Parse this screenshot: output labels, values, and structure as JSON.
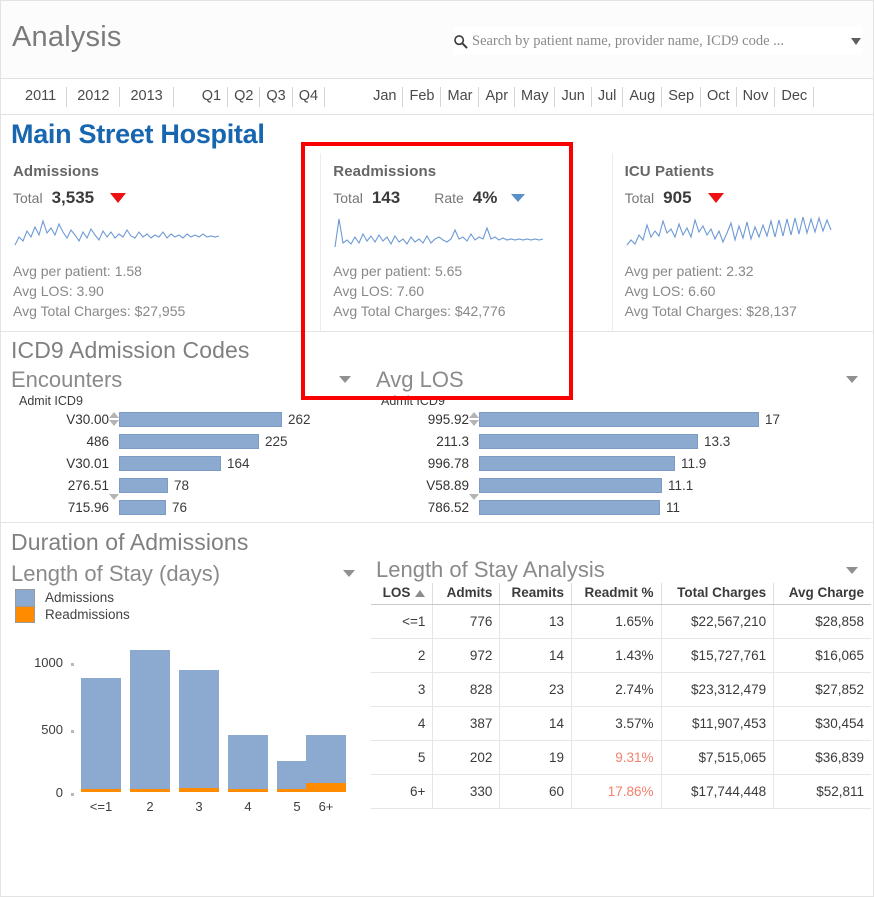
{
  "header": {
    "app_title": "Analysis",
    "search_placeholder": "Search by patient name, provider name, ICD9 code ...",
    "search_value": "",
    "search_icon": "search-icon",
    "dropdown_icon": "chevron-down-icon"
  },
  "filters": {
    "years": [
      "2011",
      "2012",
      "2013"
    ],
    "quarters": [
      "Q1",
      "Q2",
      "Q3",
      "Q4"
    ],
    "months": [
      "Jan",
      "Feb",
      "Mar",
      "Apr",
      "May",
      "Jun",
      "Jul",
      "Aug",
      "Sep",
      "Oct",
      "Nov",
      "Dec"
    ]
  },
  "hospital": {
    "name": "Main Street Hospital"
  },
  "cards": [
    {
      "title": "Admissions",
      "total_label": "Total",
      "total_value": "3,535",
      "secondary_label": "",
      "secondary_value": "",
      "caret_color": "#ee1111",
      "stats": [
        "Avg per patient: 1.58",
        "Avg LOS: 3.90",
        "Avg Total Charges: $27,955"
      ]
    },
    {
      "title": "Readmissions",
      "total_label": "Total",
      "total_value": "143",
      "secondary_label": "Rate",
      "secondary_value": "4%",
      "caret_color": "#5b8fc9",
      "stats": [
        "Avg per patient: 5.65",
        "Avg LOS: 7.60",
        "Avg Total Charges: $42,776"
      ]
    },
    {
      "title": "ICU Patients",
      "total_label": "Total",
      "total_value": "905",
      "secondary_label": "",
      "secondary_value": "",
      "caret_color": "#ee1111",
      "stats": [
        "Avg per patient: 2.32",
        "Avg LOS: 6.60",
        "Avg Total Charges: $28,137"
      ]
    }
  ],
  "icd_section": {
    "heading": "ICD9 Admission Codes",
    "left": {
      "subtitle": "Encounters",
      "axis_label": "Admit ICD9"
    },
    "right": {
      "subtitle": "Avg LOS",
      "axis_label": "Admit ICD9"
    }
  },
  "duration_section": {
    "heading": "Duration of Admissions",
    "chart_subtitle": "Length of Stay (days)",
    "table_subtitle": "Length of Stay Analysis",
    "legend": [
      "Admissions",
      "Readmissions"
    ],
    "legend_colors": [
      "#8ca9cf",
      "#ff8c00"
    ]
  },
  "los_table": {
    "columns": [
      "LOS",
      "Admits",
      "Reamits",
      "Readmit %",
      "Total Charges",
      "Avg Charge"
    ],
    "sort_column": "LOS",
    "rows": [
      {
        "los": "<=1",
        "admits": "776",
        "reamits": "13",
        "readmit_pct": "1.65%",
        "alert": false,
        "total_charges": "$22,567,210",
        "avg_charge": "$28,858"
      },
      {
        "los": "2",
        "admits": "972",
        "reamits": "14",
        "readmit_pct": "1.43%",
        "alert": false,
        "total_charges": "$15,727,761",
        "avg_charge": "$16,065"
      },
      {
        "los": "3",
        "admits": "828",
        "reamits": "23",
        "readmit_pct": "2.74%",
        "alert": false,
        "total_charges": "$23,312,479",
        "avg_charge": "$27,852"
      },
      {
        "los": "4",
        "admits": "387",
        "reamits": "14",
        "readmit_pct": "3.57%",
        "alert": false,
        "total_charges": "$11,907,453",
        "avg_charge": "$30,454"
      },
      {
        "los": "5",
        "admits": "202",
        "reamits": "19",
        "readmit_pct": "9.31%",
        "alert": true,
        "total_charges": "$7,515,065",
        "avg_charge": "$36,839"
      },
      {
        "los": "6+",
        "admits": "330",
        "reamits": "60",
        "readmit_pct": "17.86%",
        "alert": true,
        "total_charges": "$17,744,448",
        "avg_charge": "$52,811"
      }
    ]
  },
  "annotation": {
    "color": "#fb0000",
    "target": "readmissions-card"
  },
  "chart_data": [
    {
      "type": "bar",
      "orientation": "horizontal",
      "title": "Encounters",
      "xlabel": "",
      "ylabel": "Admit ICD9",
      "categories": [
        "V30.00",
        "486",
        "V30.01",
        "276.51",
        "715.96"
      ],
      "values": [
        262,
        225,
        164,
        78,
        76
      ],
      "xlim": [
        0,
        262
      ],
      "bar_color": "#8ca9cf",
      "grid": false
    },
    {
      "type": "bar",
      "orientation": "horizontal",
      "title": "Avg LOS",
      "xlabel": "",
      "ylabel": "Admit ICD9",
      "categories": [
        "995.92",
        "211.3",
        "996.78",
        "V58.89",
        "786.52"
      ],
      "values": [
        17.0,
        13.3,
        11.9,
        11.1,
        11.0
      ],
      "xlim": [
        0,
        17.0
      ],
      "bar_color": "#8ca9cf",
      "grid": false
    },
    {
      "type": "bar",
      "stacked": true,
      "orientation": "vertical",
      "title": "Length of Stay (days)",
      "xlabel": "",
      "ylabel": "",
      "categories": [
        "<=1",
        "2",
        "3",
        "4",
        "5",
        "6+"
      ],
      "series": [
        {
          "name": "Admissions",
          "values": [
            776,
            972,
            828,
            387,
            202,
            330
          ],
          "color": "#8ca9cf"
        },
        {
          "name": "Readmissions",
          "values": [
            13,
            14,
            23,
            14,
            19,
            60
          ],
          "color": "#ff8c00"
        }
      ],
      "yticks": [
        0,
        500,
        1000
      ],
      "ylim": [
        0,
        1050
      ],
      "legend_position": "top-left",
      "grid": false
    },
    {
      "type": "table",
      "title": "Length of Stay Analysis",
      "columns": [
        "LOS",
        "Admits",
        "Reamits",
        "Readmit %",
        "Total Charges",
        "Avg Charge"
      ],
      "rows": [
        [
          "<=1",
          776,
          13,
          "1.65%",
          "$22,567,210",
          "$28,858"
        ],
        [
          "2",
          972,
          14,
          "1.43%",
          "$15,727,761",
          "$16,065"
        ],
        [
          "3",
          828,
          23,
          "2.74%",
          "$23,312,479",
          "$27,852"
        ],
        [
          "4",
          387,
          14,
          "3.57%",
          "$11,907,453",
          "$30,454"
        ],
        [
          "5",
          202,
          19,
          "9.31%",
          "$7,515,065",
          "$36,839"
        ],
        [
          "6+",
          330,
          60,
          "17.86%",
          "$17,744,448",
          "$52,811"
        ]
      ]
    },
    {
      "type": "line",
      "title": "Admissions sparkline",
      "values": [
        22,
        34,
        26,
        40,
        30,
        46,
        34,
        52,
        38,
        44,
        36,
        50,
        40,
        34,
        44,
        38,
        30,
        42,
        34,
        46,
        38,
        32,
        44,
        36,
        42,
        34,
        40,
        36,
        44,
        38,
        34,
        42,
        36,
        40,
        34,
        38,
        36,
        42,
        34,
        40,
        36,
        38,
        34,
        40,
        36,
        38
      ],
      "color": "#6e9ad4"
    },
    {
      "type": "line",
      "title": "Readmissions sparkline",
      "values": [
        14,
        80,
        24,
        28,
        22,
        34,
        24,
        40,
        26,
        36,
        24,
        38,
        26,
        34,
        22,
        36,
        24,
        30,
        22,
        34,
        26,
        30,
        24,
        36,
        22,
        30,
        26,
        34,
        24,
        30,
        40,
        30,
        34,
        26,
        38,
        28,
        34,
        30,
        46,
        30,
        34,
        28,
        32,
        28,
        30,
        28
      ],
      "color": "#6e9ad4"
    },
    {
      "type": "line",
      "title": "ICU Patients sparkline",
      "values": [
        18,
        26,
        20,
        34,
        26,
        48,
        30,
        40,
        32,
        56,
        36,
        42,
        30,
        52,
        34,
        46,
        30,
        58,
        36,
        50,
        34,
        44,
        28,
        40,
        24,
        36,
        52,
        26,
        48,
        30,
        54,
        28,
        46,
        32,
        50,
        34,
        56,
        30,
        58,
        34,
        60,
        36,
        62,
        38,
        64,
        40
      ],
      "color": "#6e9ad4"
    }
  ]
}
